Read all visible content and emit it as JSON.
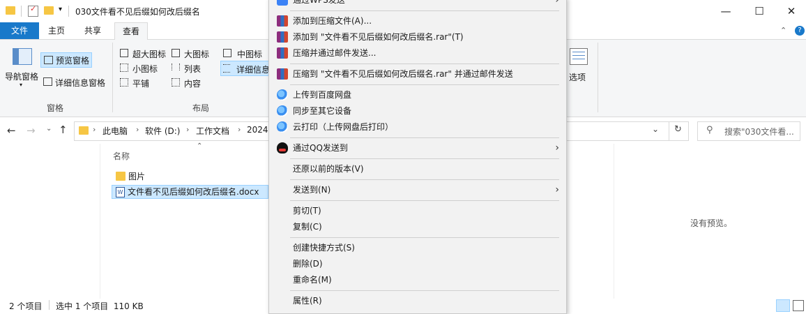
{
  "window": {
    "title": "030文件看不见后缀如何改后缀名",
    "controls": {
      "minimize": "—",
      "maximize": "☐",
      "close": "✕"
    }
  },
  "ribbon_tabs": [
    "文件",
    "主页",
    "共享",
    "查看"
  ],
  "ribbon": {
    "nav_pane": "导航窗格",
    "preview_pane": "预览窗格",
    "details_pane": "详细信息窗格",
    "group_panes": "窗格",
    "layout_items": [
      "超大图标",
      "大图标",
      "中图标",
      "小图标",
      "列表",
      "详细信息",
      "平铺",
      "内容"
    ],
    "group_layout": "布局",
    "options": "选项"
  },
  "address": {
    "segments": [
      "此电脑",
      "软件 (D:)",
      "工作文档",
      "2024"
    ],
    "search_placeholder": "搜索\"030文件看..."
  },
  "file_list": {
    "column_name": "名称",
    "items": [
      {
        "name": "图片",
        "type": "folder"
      },
      {
        "name": "文件看不见后缀如何改后缀名.docx",
        "type": "docx",
        "selected": true
      }
    ]
  },
  "preview": {
    "empty_text": "没有预览。"
  },
  "status": {
    "count": "2 个项目",
    "selection": "选中 1 个项目  110 KB"
  },
  "context_menu": {
    "top_partial": "通过WPS发送",
    "items": [
      {
        "label": "添加到压缩文件(A)...",
        "icon": "winrar-icon"
      },
      {
        "label": "添加到 \"文件看不见后缀如何改后缀名.rar\"(T)",
        "icon": "winrar-icon"
      },
      {
        "label": "压缩并通过邮件发送...",
        "icon": "winrar-icon"
      },
      {
        "label": "压缩到 \"文件看不见后缀如何改后缀名.rar\" 并通过邮件发送",
        "icon": "winrar-icon"
      },
      {
        "label": "上传到百度网盘",
        "icon": "baidu-netdisk-icon"
      },
      {
        "label": "同步至其它设备",
        "icon": "baidu-netdisk-icon"
      },
      {
        "label": "云打印（上传网盘后打印）",
        "icon": "baidu-netdisk-icon"
      },
      {
        "label": "通过QQ发送到",
        "icon": "qq-icon",
        "submenu": true
      },
      {
        "label": "还原以前的版本(V)"
      },
      {
        "label": "发送到(N)",
        "submenu": true
      },
      {
        "label": "剪切(T)"
      },
      {
        "label": "复制(C)"
      },
      {
        "label": "创建快捷方式(S)"
      },
      {
        "label": "删除(D)"
      },
      {
        "label": "重命名(M)"
      },
      {
        "label": "属性(R)"
      }
    ]
  },
  "colors": {
    "accent": "#1979ca",
    "selection": "#cce8ff",
    "selection_border": "#99d1ff",
    "folder": "#f6c644"
  }
}
